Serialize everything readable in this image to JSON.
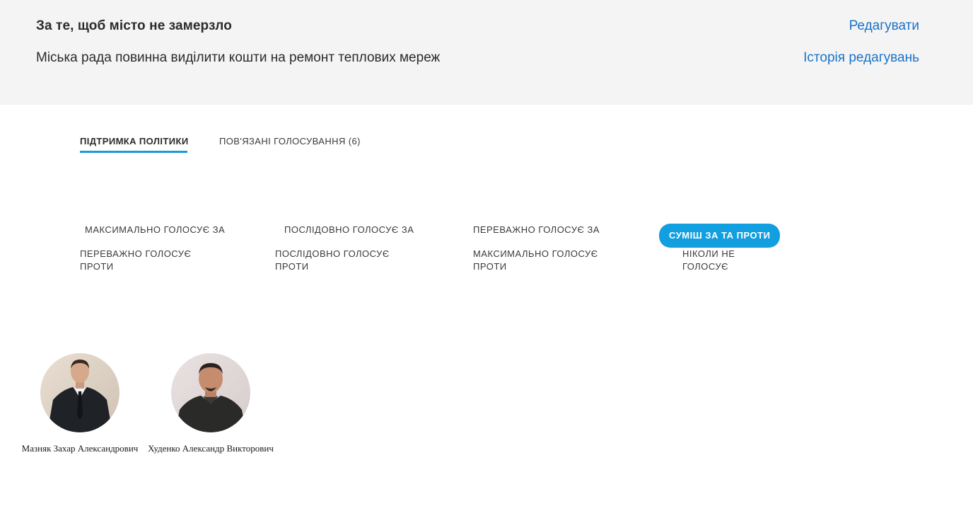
{
  "policy": {
    "title": "За те, щоб місто не замерзло",
    "description": "Міська рада повинна виділити кошти на ремонт теплових мереж"
  },
  "header_links": {
    "edit": "Редагувати",
    "history": "Історія редагувань"
  },
  "tabs": [
    {
      "label": "ПІДТРИМКА ПОЛІТИКИ",
      "active": true
    },
    {
      "label": "ПОВ'ЯЗАНІ ГОЛОСУВАННЯ (6)",
      "active": false
    }
  ],
  "filters": [
    {
      "label": "МАКСИМАЛЬНО ГОЛОСУЄ ЗА",
      "active": false
    },
    {
      "label": "ПОСЛІДОВНО ГОЛОСУЄ ЗА",
      "active": false
    },
    {
      "label": "ПЕРЕВАЖНО ГОЛОСУЄ ЗА",
      "active": false
    },
    {
      "label": "СУМІШ ЗА ТА ПРОТИ",
      "active": true
    },
    {
      "label": "ПЕРЕВАЖНО ГОЛОСУЄ ПРОТИ",
      "active": false
    },
    {
      "label": "ПОСЛІДОВНО ГОЛОСУЄ ПРОТИ",
      "active": false
    },
    {
      "label": "МАКСИМАЛЬНО ГОЛОСУЄ ПРОТИ",
      "active": false
    },
    {
      "label": "НІКОЛИ НЕ ГОЛОСУЄ",
      "active": false
    }
  ],
  "people": [
    {
      "name": "Мазняк Захар Александрович"
    },
    {
      "name": "Худенко Александр Викторович"
    }
  ],
  "colors": {
    "accent": "#129fe0",
    "link": "#1a73c8",
    "header_bg": "#f4f4f4"
  }
}
